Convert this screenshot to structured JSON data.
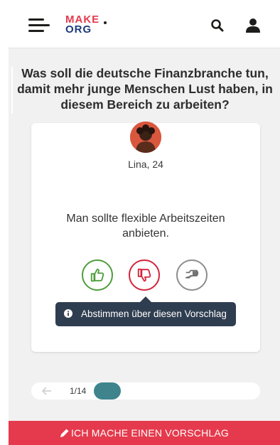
{
  "header": {
    "logo_top": "MAKE",
    "logo_bottom": "ORG"
  },
  "question": "Was soll die deutsche Finanzbranche tun, damit mehr junge Menschen Lust haben, in diesem Bereich zu arbeiten?",
  "proposal": {
    "author": "Lina, 24",
    "text": "Man sollte flexible Arbeitszeiten anbieten.",
    "tooltip": "Abstimmen über diesen Vorschlag"
  },
  "progress": {
    "counter": "1/14",
    "current": 1,
    "total": 14
  },
  "cta": {
    "label": "ICH MACHE EINEN VORSCHLAG"
  },
  "colors": {
    "brand_red": "#e53a4d",
    "brand_blue": "#1a3b7b",
    "agree": "#4e9d3a",
    "disagree": "#d2243b",
    "neutral": "#8c8c8c",
    "progress": "#3f848c",
    "tooltip": "#2f3d50"
  },
  "icons": [
    "menu-icon",
    "search-icon",
    "account-icon",
    "thumbs-up-icon",
    "thumbs-down-icon",
    "neutral-hand-icon",
    "info-icon",
    "arrow-left-icon",
    "pencil-icon"
  ]
}
